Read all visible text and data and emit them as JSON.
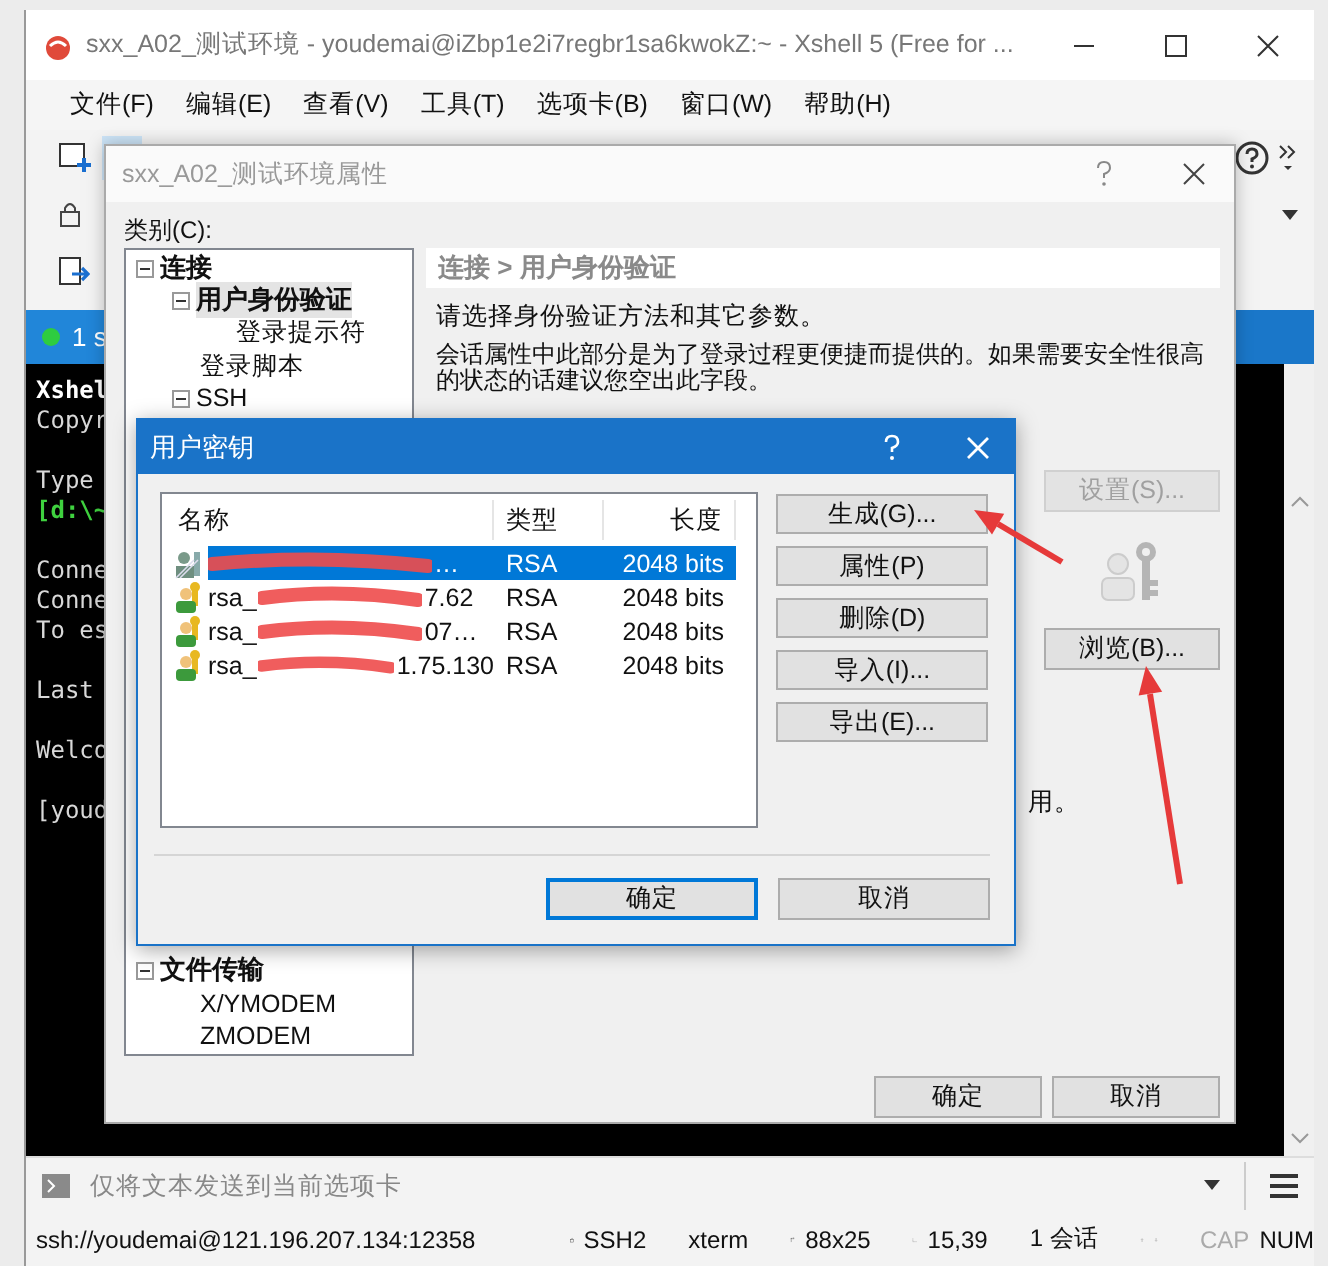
{
  "main_window": {
    "title": "sxx_A02_测试环境 - youdemai@iZbp1e2i7regbr1sa6kwokZ:~ - Xshell 5 (Free for ...",
    "menu": [
      "文件(F)",
      "编辑(E)",
      "查看(V)",
      "工具(T)",
      "选项卡(B)",
      "窗口(W)",
      "帮助(H)"
    ],
    "tab": {
      "label": "1 s"
    },
    "terminal": {
      "blocks": [
        [
          {
            "text": "Xshel",
            "kind": "bold"
          },
          {
            "text": "Copyr",
            "kind": "plain"
          }
        ],
        [
          {
            "text": "Type",
            "kind": "plain"
          },
          {
            "text": "[d:\\~",
            "kind": "prompt"
          }
        ],
        [
          {
            "text": "Conne",
            "kind": "plain"
          },
          {
            "text": "Conne",
            "kind": "plain"
          },
          {
            "text": "To es",
            "kind": "plain"
          }
        ],
        [
          {
            "text": "Last",
            "kind": "plain"
          }
        ],
        [
          {
            "text": "Welco",
            "kind": "plain"
          }
        ],
        [
          {
            "text": "[youd",
            "kind": "plain"
          }
        ]
      ]
    },
    "send_bar": {
      "placeholder": "仅将文本发送到当前选项卡"
    },
    "status_bar": {
      "address": "ssh://youdemai@121.196.207.134:12358",
      "protocol": "SSH2",
      "terminal_type": "xterm",
      "size": "88x25",
      "cursor": "15,39",
      "sessions": "1 会话",
      "caps": {
        "label": "CAP",
        "on": false
      },
      "num": {
        "label": "NUM",
        "on": true
      }
    }
  },
  "properties_dialog": {
    "title": "sxx_A02_测试环境属性",
    "category_label": "类别(C):",
    "tree_top": [
      {
        "label": "连接",
        "expanded": true,
        "selected": false,
        "children": [
          {
            "label": "用户身份验证",
            "expanded": true,
            "selected": true,
            "children": [
              {
                "label": "登录提示符",
                "selected": false
              }
            ]
          },
          {
            "label": "登录脚本",
            "selected": false
          },
          {
            "label": "SSH",
            "expanded": true,
            "selected": false
          }
        ]
      }
    ],
    "tree_bottom": [
      {
        "label": "文件传输",
        "expanded": true,
        "selected": false,
        "children": [
          {
            "label": "X/YMODEM",
            "selected": false
          },
          {
            "label": "ZMODEM",
            "selected": false
          }
        ]
      }
    ],
    "heading": "连接 > 用户身份验证",
    "intro": "请选择身份验证方法和其它参数。",
    "note": "会话属性中此部分是为了登录过程更便捷而提供的。如果需要安全性很高的状态的话建议您空出此字段。",
    "setup_button": {
      "label": "设置(S)...",
      "disabled": true
    },
    "browse_button": {
      "label": "浏览(B)...",
      "disabled": false
    },
    "partial_text": "用。",
    "buttons": [
      "确定",
      "取消"
    ]
  },
  "keys_dialog": {
    "title": "用户密钥",
    "columns": [
      "名称",
      "类型",
      "长度"
    ],
    "rows": [
      {
        "name_suffix": "…",
        "type": "RSA",
        "length": "2048 bits",
        "selected": true
      },
      {
        "name_prefix": "rsa_",
        "name_suffix": "7.62",
        "type": "RSA",
        "length": "2048 bits",
        "selected": false
      },
      {
        "name_prefix": "rsa_",
        "name_suffix": "07…",
        "type": "RSA",
        "length": "2048 bits",
        "selected": false
      },
      {
        "name_prefix": "rsa_",
        "name_suffix": "1.75.130",
        "type": "RSA",
        "length": "2048 bits",
        "selected": false
      }
    ],
    "side_buttons": [
      "生成(G)...",
      "属性(P)",
      "删除(D)",
      "导入(I)...",
      "导出(E)..."
    ],
    "buttons": [
      {
        "label": "确定",
        "default": true
      },
      {
        "label": "取消",
        "default": false
      }
    ]
  }
}
